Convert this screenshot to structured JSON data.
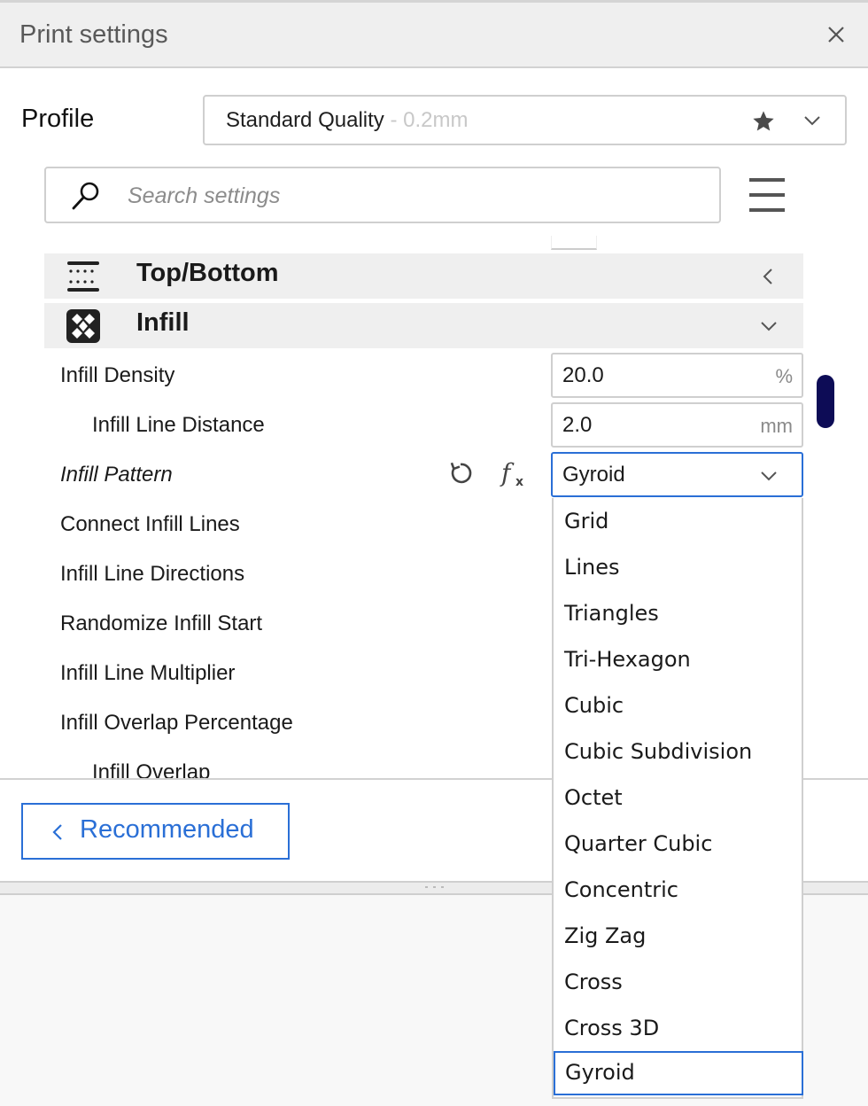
{
  "window": {
    "title": "Print settings",
    "close_icon": "close-icon"
  },
  "profile": {
    "label": "Profile",
    "name": "Standard Quality",
    "detail": " - 0.2mm",
    "favorite_icon": "star-icon",
    "dropdown_icon": "chevron-down-icon"
  },
  "search": {
    "placeholder": "Search settings",
    "value": "",
    "icon": "search-icon",
    "menu_icon": "hamburger-menu-icon"
  },
  "categories": [
    {
      "label": "Top/Bottom",
      "icon": "top-bottom-icon",
      "state": "collapsed"
    },
    {
      "label": "Infill",
      "icon": "infill-icon",
      "state": "expanded"
    }
  ],
  "settings": [
    {
      "label": "Infill Density",
      "value": "20.0",
      "unit": "%",
      "indent": false
    },
    {
      "label": "Infill Line Distance",
      "value": "2.0",
      "unit": "mm",
      "indent": true
    },
    {
      "label": "Infill Pattern",
      "value": "Gyroid",
      "type": "combo",
      "modified": true,
      "reset_icon": "reset-icon",
      "function_icon": "function-fx-icon"
    },
    {
      "label": "Connect Infill Lines"
    },
    {
      "label": "Infill Line Directions"
    },
    {
      "label": "Randomize Infill Start"
    },
    {
      "label": "Infill Line Multiplier"
    },
    {
      "label": "Infill Overlap Percentage"
    },
    {
      "label": "Infill Overlap",
      "indent": true
    }
  ],
  "dropdown": {
    "selected": "Gyroid",
    "options": [
      "Grid",
      "Lines",
      "Triangles",
      "Tri-Hexagon",
      "Cubic",
      "Cubic Subdivision",
      "Octet",
      "Quarter Cubic",
      "Concentric",
      "Zig Zag",
      "Cross",
      "Cross 3D",
      "Gyroid"
    ]
  },
  "footer": {
    "recommended_label": "Recommended"
  },
  "colors": {
    "accent": "#2a6fd6",
    "scrollbar": "#0d0c56",
    "category_bg": "#efefef"
  }
}
